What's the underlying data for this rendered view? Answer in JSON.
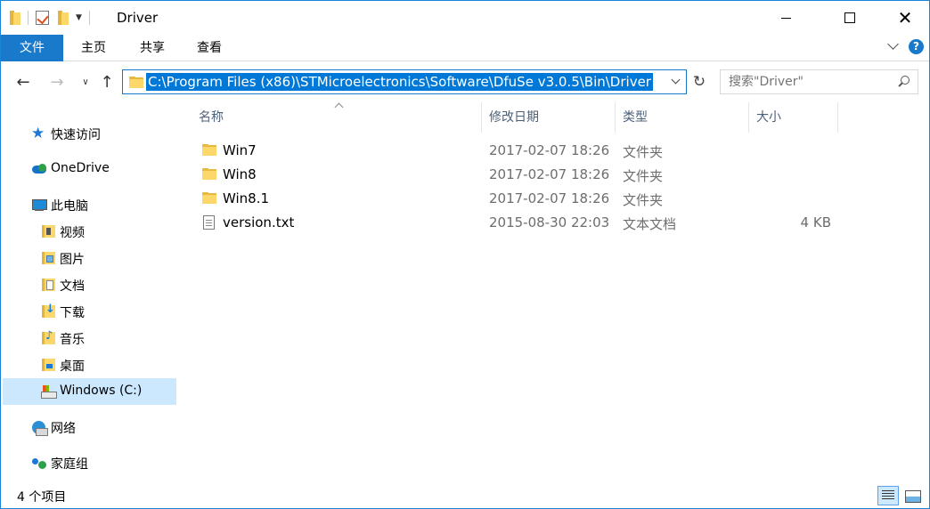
{
  "window": {
    "title": "Driver"
  },
  "ribbon": {
    "tabs": [
      {
        "label": "文件"
      },
      {
        "label": "主页"
      },
      {
        "label": "共享"
      },
      {
        "label": "查看"
      }
    ],
    "help_label": "?"
  },
  "navigation": {
    "address_path": "C:\\Program Files (x86)\\STMicroelectronics\\Software\\DfuSe v3.0.5\\Bin\\Driver",
    "search_placeholder": "搜索\"Driver\""
  },
  "nav_pane": {
    "items": [
      {
        "label": "快速访问",
        "icon": "quick-access-star-icon"
      },
      {
        "label": "OneDrive",
        "icon": "onedrive-cloud-icon"
      },
      {
        "label": "此电脑",
        "icon": "this-pc-icon"
      },
      {
        "label": "视频",
        "icon": "videos-folder-icon"
      },
      {
        "label": "图片",
        "icon": "pictures-folder-icon"
      },
      {
        "label": "文档",
        "icon": "documents-folder-icon"
      },
      {
        "label": "下载",
        "icon": "downloads-folder-icon"
      },
      {
        "label": "音乐",
        "icon": "music-folder-icon"
      },
      {
        "label": "桌面",
        "icon": "desktop-folder-icon"
      },
      {
        "label": "Windows (C:)",
        "icon": "drive-icon",
        "selected": true
      },
      {
        "label": "网络",
        "icon": "network-icon"
      },
      {
        "label": "家庭组",
        "icon": "homegroup-icon"
      }
    ]
  },
  "file_list": {
    "columns": [
      "名称",
      "修改日期",
      "类型",
      "大小"
    ],
    "rows": [
      {
        "name": "Win7",
        "date": "2017-02-07 18:26",
        "type": "文件夹",
        "size": "",
        "icon": "folder-icon"
      },
      {
        "name": "Win8",
        "date": "2017-02-07 18:26",
        "type": "文件夹",
        "size": "",
        "icon": "folder-icon"
      },
      {
        "name": "Win8.1",
        "date": "2017-02-07 18:26",
        "type": "文件夹",
        "size": "",
        "icon": "folder-icon"
      },
      {
        "name": "version.txt",
        "date": "2015-08-30 22:03",
        "type": "文本文档",
        "size": "4 KB",
        "icon": "text-file-icon"
      }
    ]
  },
  "status_bar": {
    "item_count": "4 个项目"
  },
  "colors": {
    "accent": "#1979ca",
    "selection": "#0078d7",
    "nav_selected": "#cce8ff",
    "folder": "#fcd76a"
  }
}
